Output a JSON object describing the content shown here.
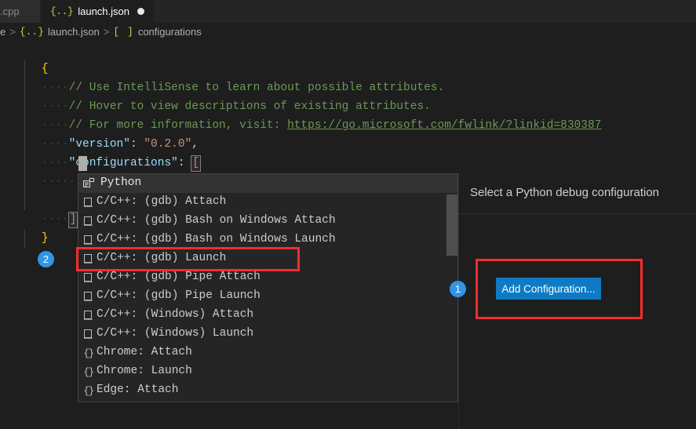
{
  "window": {
    "background": "#1e1e1e",
    "accent": "#0e7ac4",
    "annotation_color": "#fb2c2c",
    "badge_color": "#2f96e8"
  },
  "tabs": [
    {
      "label": ".cpp",
      "icon": "cpp-file-icon",
      "active": false,
      "dirty": false
    },
    {
      "label": "launch.json",
      "icon": "json-file-icon",
      "active": true,
      "dirty": true,
      "icon_glyph": "{..}"
    }
  ],
  "breadcrumb": {
    "segments": [
      {
        "label": "e",
        "icon": ""
      },
      {
        "label": "launch.json",
        "icon": "{..}"
      },
      {
        "label": "configurations",
        "icon": "[ ]"
      }
    ],
    "separator": ">"
  },
  "editor": {
    "language": "json",
    "lines": [
      {
        "indent": "",
        "tokens": [
          {
            "t": "{",
            "c": "br-y"
          }
        ]
      },
      {
        "indent": "····",
        "tokens": [
          {
            "t": "// Use IntelliSense to learn about possible attributes.",
            "c": "cmt"
          }
        ]
      },
      {
        "indent": "····",
        "tokens": [
          {
            "t": "// Hover to view descriptions of existing attributes.",
            "c": "cmt"
          }
        ]
      },
      {
        "indent": "····",
        "tokens": [
          {
            "t": "// For more information, visit: ",
            "c": "cmt"
          },
          {
            "t": "https://go.microsoft.com/fwlink/?linkid=830387",
            "c": "lnk"
          }
        ]
      },
      {
        "indent": "····",
        "tokens": [
          {
            "t": "\"version\"",
            "c": "key"
          },
          {
            "t": ": ",
            "c": "pun"
          },
          {
            "t": "\"0.2.0\"",
            "c": "str"
          },
          {
            "t": ",",
            "c": "pun"
          }
        ]
      },
      {
        "indent": "····",
        "tokens": [
          {
            "t": "\"configurations\"",
            "c": "key"
          },
          {
            "t": ": ",
            "c": "pun"
          },
          {
            "t": "[",
            "c": "br-m"
          }
        ]
      },
      {
        "indent": "········",
        "tokens": []
      },
      {
        "indent": "····",
        "tokens": [
          {
            "t": "]",
            "c": "br-m"
          }
        ]
      },
      {
        "indent": "",
        "tokens": [
          {
            "t": "}",
            "c": "br-y"
          }
        ]
      }
    ],
    "url_text": "https://go.microsoft.com/fwlink/?linkid=830387",
    "version_value": "0.2.0"
  },
  "quickpick": {
    "group_label": "Python",
    "group_icon": "extension-icon",
    "items": [
      {
        "label": "C/C++: (gdb) Attach",
        "icon": "blank-file-icon"
      },
      {
        "label": "C/C++: (gdb) Bash on Windows Attach",
        "icon": "blank-file-icon"
      },
      {
        "label": "C/C++: (gdb) Bash on Windows Launch",
        "icon": "blank-file-icon"
      },
      {
        "label": "C/C++: (gdb) Launch",
        "icon": "blank-file-icon",
        "highlighted": true
      },
      {
        "label": "C/C++: (gdb) Pipe Attach",
        "icon": "blank-file-icon"
      },
      {
        "label": "C/C++: (gdb) Pipe Launch",
        "icon": "blank-file-icon"
      },
      {
        "label": "C/C++: (Windows) Attach",
        "icon": "blank-file-icon"
      },
      {
        "label": "C/C++: (Windows) Launch",
        "icon": "blank-file-icon"
      },
      {
        "label": "Chrome: Attach",
        "icon": "braces-icon"
      },
      {
        "label": "Chrome: Launch",
        "icon": "braces-icon"
      },
      {
        "label": "Edge: Attach",
        "icon": "braces-icon"
      }
    ]
  },
  "sidepanel": {
    "title": "Select a Python debug configuration",
    "add_configuration_label": "Add Configuration..."
  },
  "annotations": [
    {
      "id": "1",
      "target": "add-configuration-button"
    },
    {
      "id": "2",
      "target": "quickpick-item-gdb-launch"
    }
  ]
}
